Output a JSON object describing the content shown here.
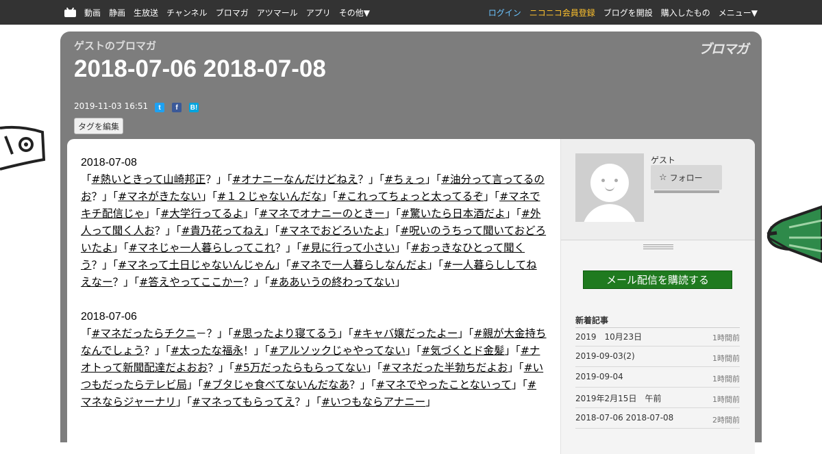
{
  "topbar": {
    "nav": [
      "動画",
      "静画",
      "生放送",
      "チャンネル",
      "ブロマガ",
      "アツマール",
      "アプリ",
      "その他▼"
    ],
    "login": "ログイン",
    "register": "ニコニコ会員登録",
    "open_blog": "ブログを開設",
    "purchased": "購入したもの",
    "menu": "メニュー▼"
  },
  "header": {
    "blog_name": "ゲストのブロマガ",
    "logo_text": "ブロマガ",
    "title": "2018-07-06 2018-07-08",
    "datetime": "2019-11-03 16:51",
    "tag_edit": "タグを編集"
  },
  "article": {
    "sections": [
      {
        "date": "2018-07-08",
        "tags": [
          "#熱いときって山崎邦正",
          "#オナニーなんだけどねえ",
          "#ちぇっ",
          "#油分って言ってるのお",
          "#マネがきたない",
          "#１２じゃないんだな",
          "#これってちょっと太ってるぞ",
          "#マネでキチ配信じゃ",
          "#大学行ってるよ",
          "#マネでオナニーのときー",
          "#驚いたら日本酒だよ",
          "#外人って聞く人お",
          "#貴乃花ってねえ",
          "#マネでおどろいたよ",
          "#呪いのうちって聞いておどろいたよ",
          "#マネじゃ一人暮らしってこれ",
          "#見に行って小さい",
          "#おっきなひとって聞くう",
          "#マネって土日じゃないんじゃん",
          "#マネで一人暮らしなんだよ",
          "#一人暮らししてねえなー",
          "#答えやってここかー",
          "#ああいうの終わってない"
        ]
      },
      {
        "date": "2018-07-06",
        "tags": [
          "#マネだったらチクニ",
          "#思ったより寝てるう",
          "#キャバ嬢だったよー",
          "#親が大金持ちなんでしょう",
          "#太ったな福永",
          "#アルソックじゃやってない",
          "#気づくとド金髪",
          "#ナオトって新聞配達だよおお",
          "#5万だったらもらってない",
          "#マネだった半勃ちだよお",
          "#いつもだったらテレビ局",
          "#ブタじゃ食べてないんだなあ",
          "#マネでやったことないって",
          "#マネならジャーナリ",
          "#マネってもらってえ",
          "#いつもならアナニー"
        ]
      }
    ]
  },
  "sidebar": {
    "user_name": "ゲスト",
    "follow": "フォロー",
    "subscribe": "メール配信を購読する",
    "recent_title": "新着記事",
    "recent": [
      {
        "title": "2019　10月23日",
        "ago": "1時間前"
      },
      {
        "title": "2019-09-03(2)",
        "ago": "1時間前"
      },
      {
        "title": "2019-09-04",
        "ago": "1時間前"
      },
      {
        "title": "2019年2月15日　午前",
        "ago": "1時間前"
      },
      {
        "title": "2018-07-06 2018-07-08",
        "ago": "2時間前"
      }
    ]
  }
}
